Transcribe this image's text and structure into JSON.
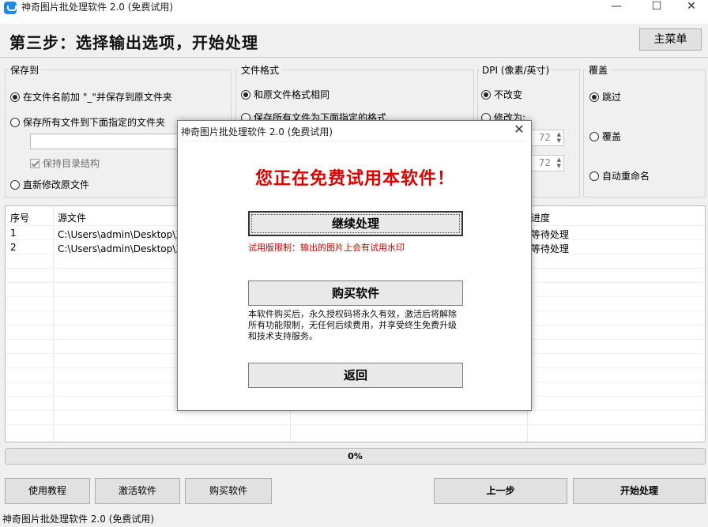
{
  "window": {
    "title": "神奇图片批处理软件 2.0 (免费试用)",
    "minimize_glyph": "—",
    "maximize_glyph": "☐",
    "close_glyph": "✕"
  },
  "header": {
    "title": "第三步：选择输出选项，开始处理",
    "main_menu_label": "主菜单"
  },
  "save_to": {
    "label": "保存到",
    "opt_prefix": "在文件名前加 \"_\"并保存到原文件夹",
    "opt_folder": "保存所有文件到下面指定的文件夹",
    "folder_value": "",
    "keep_structure": "保持目录结构",
    "opt_overwrite": "直新修改原文件"
  },
  "file_format": {
    "label": "文件格式",
    "opt_same": "和原文件格式相同",
    "opt_specified": "保存所有文件为下面指定的格式"
  },
  "dpi": {
    "label": "DPI (像素/英寸)",
    "opt_keep": "不改变",
    "opt_change": "修改为:",
    "value_x": "72",
    "value_y": "72"
  },
  "overwrite": {
    "label": "覆盖",
    "opt_skip": "跳过",
    "opt_overwrite": "覆盖",
    "opt_rename": "自动重命名"
  },
  "list": {
    "columns": {
      "index": "序号",
      "source": "源文件",
      "progress": "进度"
    },
    "rows": [
      {
        "index": "1",
        "source": "C:\\Users\\admin\\Desktop\\工作",
        "progress": "等待处理"
      },
      {
        "index": "2",
        "source": "C:\\Users\\admin\\Desktop\\工作",
        "progress": "等待处理"
      }
    ]
  },
  "progress": {
    "value": 0,
    "text": "0%"
  },
  "buttons": {
    "tutorial": "使用教程",
    "activate": "激活软件",
    "buy": "购买软件",
    "prev": "上一步",
    "start": "开始处理"
  },
  "status_bar": {
    "text": "神奇图片批处理软件 2.0 (免费试用)"
  },
  "dialog": {
    "title": "神奇图片批处理软件 2.0 (免费试用)",
    "close_glyph": "✕",
    "heading": "您正在免费试用本软件！",
    "continue_label": "继续处理",
    "trial_note": "试用版限制：输出的图片上会有试用水印",
    "buy_label": "购买软件",
    "buy_desc": "本软件购买后，永久授权码将永久有效，激活后将解除所有功能限制，无任何后续费用，并享受终生免费升级和技术支持服务。",
    "back_label": "返回"
  },
  "colors": {
    "accent_red": "#e00000",
    "progress_green": "#06b025",
    "icon_blue": "#1e88e5"
  }
}
